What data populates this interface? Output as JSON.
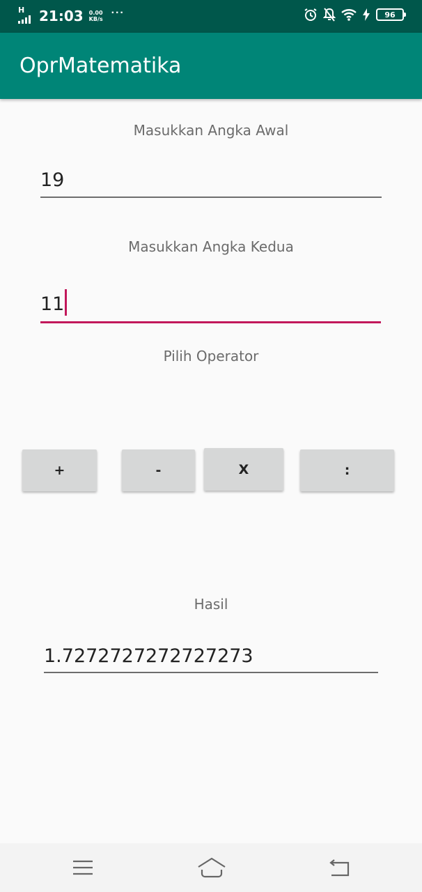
{
  "status_bar": {
    "network": "H",
    "time": "21:03",
    "speed_value": "0.00",
    "speed_unit": "KB/s",
    "more": "···",
    "battery": "96",
    "icons": [
      "signal-icon",
      "alarm-icon",
      "notifications-off-icon",
      "wifi-icon",
      "charging-icon",
      "battery-icon"
    ]
  },
  "app_bar": {
    "title": "OprMatematika"
  },
  "form": {
    "first_label": "Masukkan Angka Awal",
    "first_value": "19",
    "second_label": "Masukkan Angka Kedua",
    "second_value": "11",
    "operator_label": "Pilih Operator"
  },
  "operators": {
    "add": "+",
    "subtract": "-",
    "multiply": "X",
    "divide": ":"
  },
  "result": {
    "label": "Hasil",
    "value": "1.7272727272727273"
  },
  "nav_bar": {
    "icons": [
      "menu-icon",
      "home-icon",
      "back-icon"
    ]
  },
  "colors": {
    "status_bar": "#00574b",
    "app_bar": "#008577",
    "accent": "#c2185b",
    "button": "#d6d7d7"
  }
}
